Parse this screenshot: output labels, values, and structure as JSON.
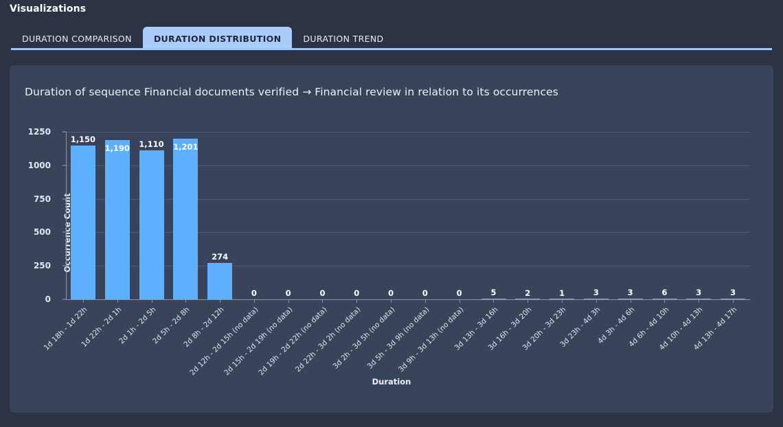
{
  "header": {
    "title": "Visualizations"
  },
  "tabs": [
    {
      "id": "duration-comparison",
      "label": "DURATION COMPARISON",
      "active": false
    },
    {
      "id": "duration-distribution",
      "label": "DURATION DISTRIBUTION",
      "active": true
    },
    {
      "id": "duration-trend",
      "label": "DURATION TREND",
      "active": false
    }
  ],
  "colors": {
    "page_background": "#2b3344",
    "panel_background": "#39435a",
    "bar": "#5cb0fd",
    "accent": "#9ec7fb",
    "active_tab_background": "#a9ccfb",
    "active_tab_text": "#1f2738",
    "grid": "#4e5a74",
    "axis": "#8d97ab",
    "text": "#eef2f8"
  },
  "chart_data": {
    "type": "bar",
    "title": "Duration of sequence Financial documents verified → Financial review in relation to its occurrences",
    "xlabel": "Duration",
    "ylabel": "Occurrence Count",
    "ylim": [
      0,
      1250
    ],
    "yticks": [
      0,
      250,
      500,
      750,
      1000,
      1250
    ],
    "ytick_labels": [
      "0",
      "250",
      "500",
      "750",
      "1000",
      "1250"
    ],
    "grid": true,
    "legend": null,
    "categories": [
      "1d 18h - 1d 22h",
      "1d 22h - 2d 1h",
      "2d 1h - 2d 5h",
      "2d 5h - 2d 8h",
      "2d 8h - 2d 12h",
      "2d 12h - 2d 15h (no data)",
      "2d 15h - 2d 19h (no data)",
      "2d 19h - 2d 22h (no data)",
      "2d 22h - 3d 2h (no data)",
      "3d 2h - 3d 5h (no data)",
      "3d 5h - 3d 9h (no data)",
      "3d 9h - 3d 13h (no data)",
      "3d 13h - 3d 16h",
      "3d 16h - 3d 20h",
      "3d 20h - 3d 23h",
      "3d 23h - 4d 3h",
      "4d 3h - 4d 6h",
      "4d 6h - 4d 10h",
      "4d 10h - 4d 13h",
      "4d 13h - 4d 17h"
    ],
    "values": [
      1150,
      1190,
      1110,
      1201,
      274,
      0,
      0,
      0,
      0,
      0,
      0,
      0,
      5,
      2,
      1,
      3,
      3,
      6,
      3,
      3
    ],
    "value_labels": [
      "1,150",
      "1,190",
      "1,110",
      "1,201",
      "274",
      "0",
      "0",
      "0",
      "0",
      "0",
      "0",
      "0",
      "5",
      "2",
      "1",
      "3",
      "3",
      "6",
      "3",
      "3"
    ],
    "label_inside": [
      false,
      true,
      false,
      true,
      false,
      false,
      false,
      false,
      false,
      false,
      false,
      false,
      false,
      false,
      false,
      false,
      false,
      false,
      false,
      false
    ]
  }
}
